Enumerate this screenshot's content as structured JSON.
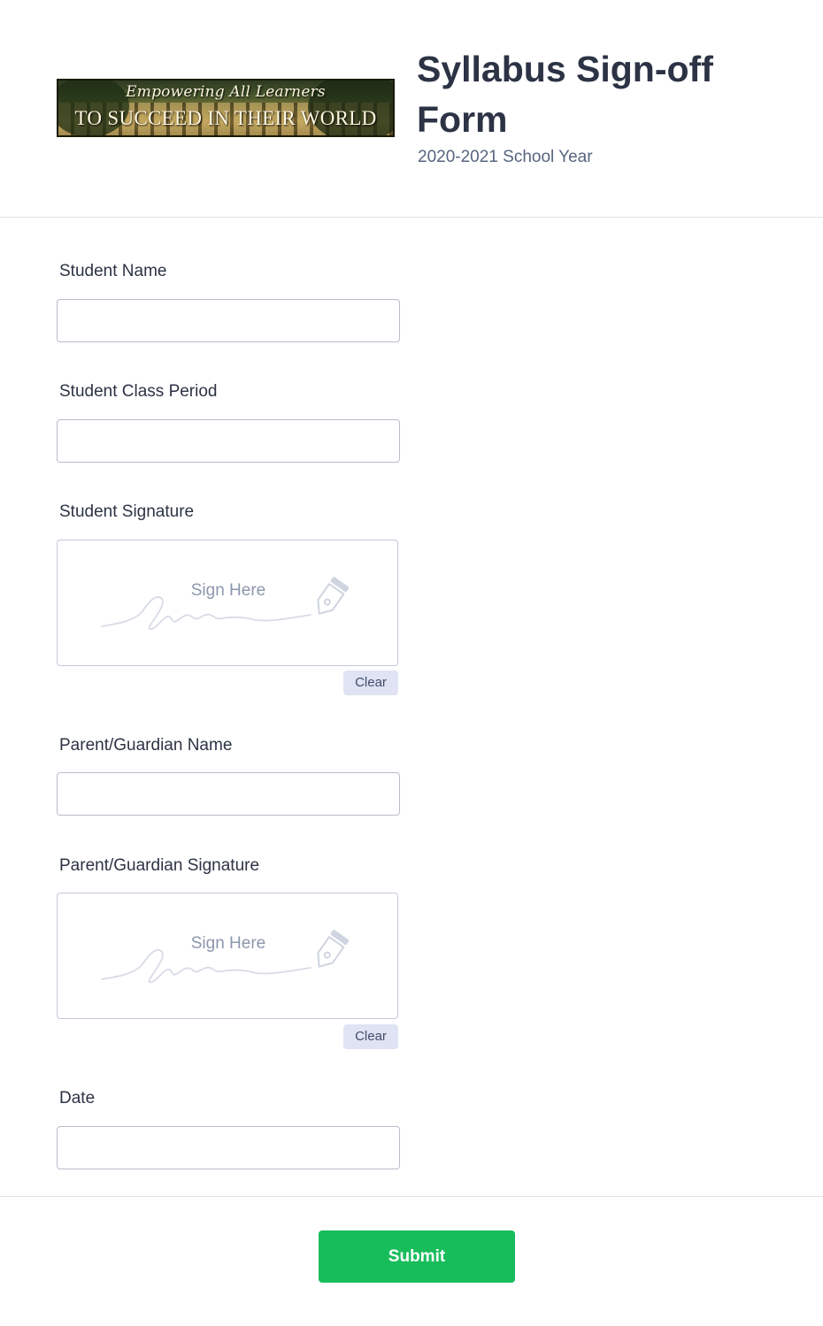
{
  "header": {
    "banner": {
      "line1": "Empowering All Learners",
      "line2": "TO SUCCEED IN THEIR WORLD"
    },
    "title": "Syllabus Sign-off Form",
    "subtitle": "2020-2021 School Year"
  },
  "fields": {
    "student_name": {
      "label": "Student Name",
      "value": ""
    },
    "class_period": {
      "label": "Student Class Period",
      "value": ""
    },
    "student_signature": {
      "label": "Student Signature",
      "placeholder": "Sign Here",
      "clear_label": "Clear"
    },
    "parent_name": {
      "label": "Parent/Guardian Name",
      "value": ""
    },
    "parent_signature": {
      "label": "Parent/Guardian Signature",
      "placeholder": "Sign Here",
      "clear_label": "Clear"
    },
    "date": {
      "label": "Date",
      "value": ""
    }
  },
  "footer": {
    "submit_label": "Submit"
  },
  "colors": {
    "accent": "#18bd5b",
    "title": "#2c3345",
    "subtitle": "#57647e",
    "clear_bg": "#dfe3f3"
  },
  "icons": {
    "signature_pen": "pen-nib-icon"
  }
}
